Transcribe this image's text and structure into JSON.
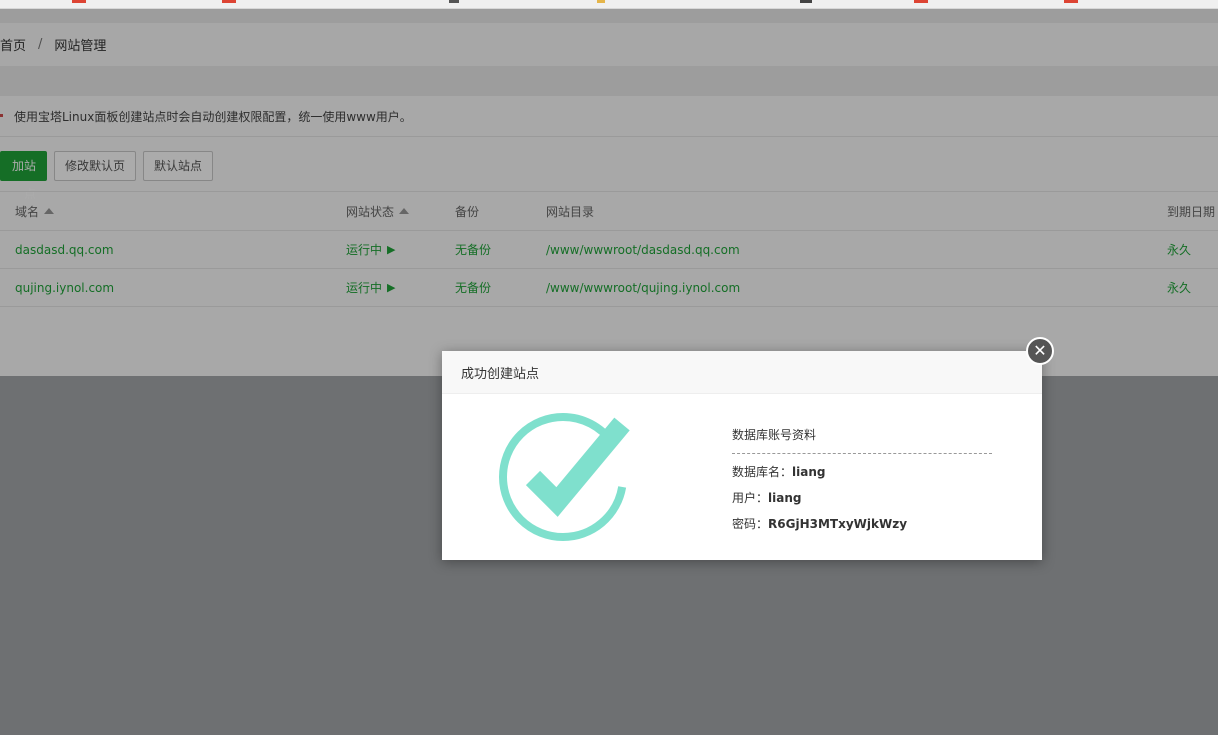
{
  "breadcrumb": {
    "home": "首页",
    "separator": "/",
    "current": "网站管理"
  },
  "tip": {
    "text": "使用宝塔Linux面板创建站点时会自动创建权限配置，统一使用www用户。"
  },
  "toolbar": {
    "add_site": "加站点",
    "edit_default_page": "修改默认页",
    "default_site": "默认站点"
  },
  "table": {
    "headers": {
      "domain": "域名",
      "status": "网站状态",
      "backup": "备份",
      "dir": "网站目录",
      "expire": "到期日期"
    },
    "rows": [
      {
        "domain": "dasdasd.qq.com",
        "status": "运行中",
        "backup": "无备份",
        "dir": "/www/wwwroot/dasdasd.qq.com",
        "expire": "永久"
      },
      {
        "domain": "qujing.iynol.com",
        "status": "运行中",
        "backup": "无备份",
        "dir": "/www/wwwroot/qujing.iynol.com",
        "expire": "永久"
      }
    ]
  },
  "modal": {
    "title": "成功创建站点",
    "close_icon": "close-icon",
    "success_icon": "check-circle-icon",
    "db_title": "数据库账号资料",
    "db_name_label": "数据库名：",
    "db_name": "liang",
    "user_label": "用户：",
    "user": "liang",
    "password_label": "密码：",
    "password": "R6GjH3MTxyWjkWzy"
  },
  "colors": {
    "accent": "#20a53a",
    "check": "#7fe0cd"
  }
}
